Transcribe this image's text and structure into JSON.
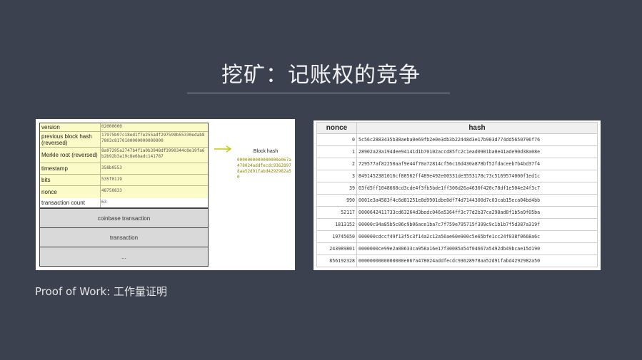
{
  "slide": {
    "title": "挖矿：记账权的竞争",
    "caption": "Proof of Work: 工作量证明"
  },
  "block_header": {
    "rows": [
      {
        "key": "version",
        "value": "02000000"
      },
      {
        "key": "previous block hash (reversed)",
        "value": "17975b97c18ed1f7e255adf297599b55330edab87803c8170100000000000000"
      },
      {
        "key": "Merkle root (reversed)",
        "value": "8a97295a2747b4f1a0b3948df3990344c0e19fa6b2b92b3a19c8e6badc141787"
      },
      {
        "key": "timestamp",
        "value": "358b0553"
      },
      {
        "key": "bits",
        "value": "535f0119"
      },
      {
        "key": "nonce",
        "value": "48750833"
      }
    ],
    "transaction_count_label": "transaction count",
    "transaction_count_value": "63",
    "coinbase_label": "coinbase transaction",
    "transaction_label": "transaction",
    "ellipsis": "..."
  },
  "block_hash": {
    "label": "Block hash",
    "value": "0000000000000000e067a478024addfecdc93628978aa52d91fabd4292982a50"
  },
  "nonce_table": {
    "headers": {
      "nonce": "nonce",
      "hash": "hash"
    },
    "rows": [
      {
        "nonce": "0",
        "hash": "5c56c2883435b38aeba0e69fb2e0e3db3b22448d3e17b903d774dd5650796f76"
      },
      {
        "nonce": "1",
        "hash": "28902a23a194dee94141d1b70102accd85fc2c1ead0901ba0e41ade90d38a08e"
      },
      {
        "nonce": "2",
        "hash": "729577af82250aaf9e44f70a72814cf56c16d430a878bf52fdaceeb7b4bd37f4"
      },
      {
        "nonce": "3",
        "hash": "8491452381016cf80562ff489e492e00331de3553178c73c5169574000f1ed1c"
      },
      {
        "nonce": "39",
        "hash": "03fd5ff1048668cd3cde4f3fb5bde1ff306d26a4630f420c78df1e504e24f3c7"
      },
      {
        "nonce": "990",
        "hash": "0001e3a4583f4c6d81251e8d9901dbe0df74d7144300d7c03cab15eca04bd4bb"
      },
      {
        "nonce": "52117",
        "hash": "0000642411733cd63264d3bedc046a5364ff3c77d2b37ca298ad8f1b5a9f05ba"
      },
      {
        "nonce": "1813152",
        "hash": "00000c94a85b5c06c9b06ace1ba7c7f759e795715f399c9c1b1b7f5d387a319f"
      },
      {
        "nonce": "19745650",
        "hash": "000000cdccf49f13f5c3f14a2c12a56ae60e900c5e65bfe1cc24f038f0668a6c"
      },
      {
        "nonce": "243989801",
        "hash": "0000000ce99e2a00633ca958a16e17f30085a54f04667a5492db49bcae15d190"
      },
      {
        "nonce": "856192328",
        "hash": "0000000000000000e067a478024addfecdc93628978aa52d91fabd4292982a50"
      }
    ]
  },
  "colors": {
    "background": "#3c4150",
    "header_fill": "#fbfbc8",
    "arrow": "#c8c800",
    "block_hash_text": "#8a8a00"
  }
}
